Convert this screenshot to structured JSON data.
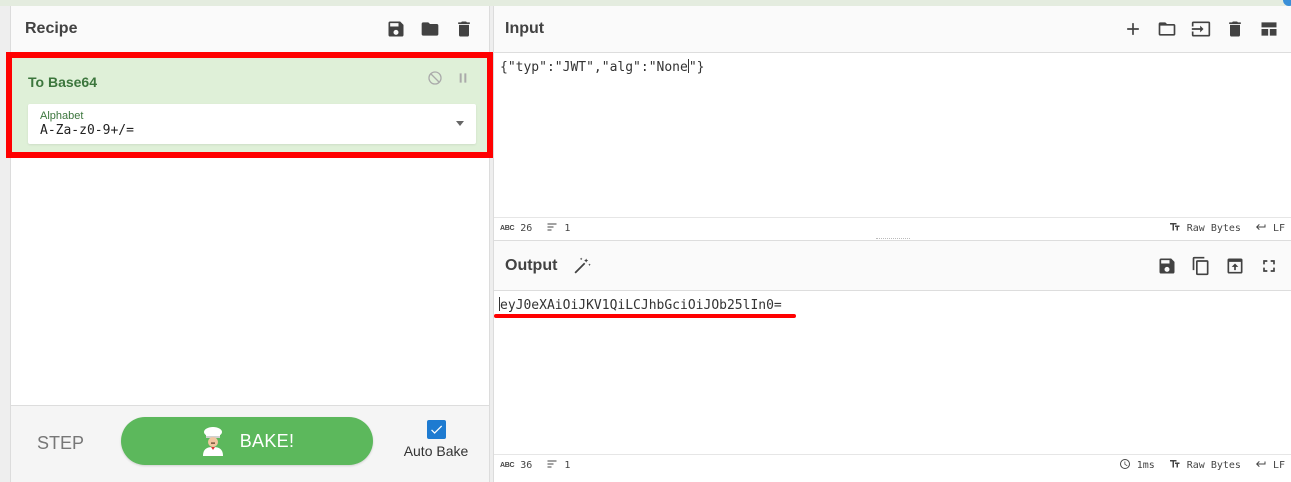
{
  "recipe": {
    "title": "Recipe",
    "operation": {
      "name": "To Base64",
      "field_label": "Alphabet",
      "field_value": "A-Za-z0-9+/="
    },
    "controls": {
      "step_label": "STEP",
      "bake_label": "BAKE!",
      "autobake_label": "Auto Bake",
      "autobake_checked": true
    }
  },
  "input": {
    "title": "Input",
    "text": "{\"typ\":\"JWT\",\"alg\":\"None\"}",
    "status": {
      "chars": "26",
      "lines": "1",
      "encoding": "Raw Bytes",
      "eol": "LF"
    }
  },
  "output": {
    "title": "Output",
    "text": "eyJ0eXAiOiJKV1QiLCJhbGciOiJOb25lIn0=",
    "status": {
      "chars": "36",
      "lines": "1",
      "time": "1ms",
      "encoding": "Raw Bytes",
      "eol": "LF"
    }
  },
  "colors": {
    "highlight": "#ff0000",
    "operation_bg": "#dff0d8",
    "operation_text": "#3c763d",
    "bake_green": "#5cb85c",
    "checkbox_blue": "#1e7bd1"
  }
}
